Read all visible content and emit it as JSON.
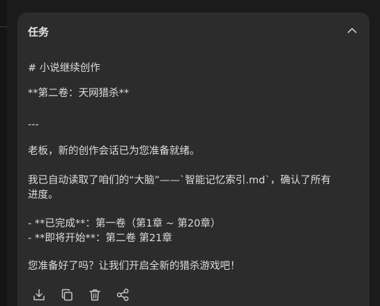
{
  "panel": {
    "title": "任务",
    "collapse_icon": "chevron-up-icon"
  },
  "message": {
    "heading": "# 小说继续创作",
    "volume": "**第二卷：天网猎杀**",
    "rule": "---",
    "greeting": "老板，新的创作会话已为您准备就绪。",
    "read_line1": "我已自动读取了咱们的“大脑”——`智能记忆索引.md`，确认了所有",
    "read_line2": "进度。",
    "done_line": "- **已完成**：第一卷（第1章 ~ 第20章）",
    "next_line": "- **即将开始**：第二卷 第21章",
    "ask_line": "您准备好了吗？让我们开启全新的猎杀游戏吧！"
  },
  "actions": [
    {
      "name": "download",
      "icon": "download-icon"
    },
    {
      "name": "copy",
      "icon": "copy-icon"
    },
    {
      "name": "delete",
      "icon": "trash-icon"
    },
    {
      "name": "share",
      "icon": "share-icon"
    }
  ],
  "colors": {
    "background": "#1b1b1b",
    "panel": "#2c2c2c",
    "text": "#dedede",
    "icon": "#c8c8c8"
  }
}
